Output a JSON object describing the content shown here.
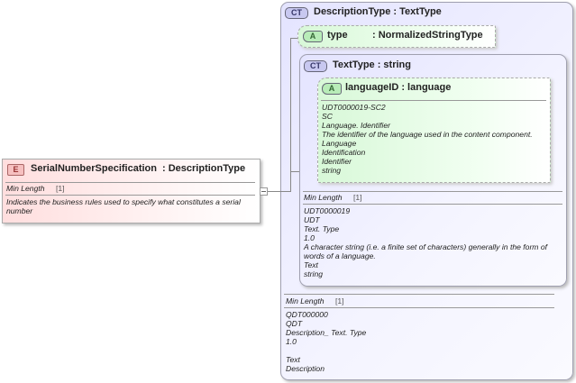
{
  "element": {
    "badge": "E",
    "name": "SerialNumberSpecification",
    "type": ": DescriptionType",
    "facet_label": "Min Length",
    "facet_value": "[1]",
    "doc": "Indicates the business rules used to specify what constitutes a serial number"
  },
  "outer": {
    "badge": "CT",
    "title": "DescriptionType : TextType",
    "facet_label": "Min Length",
    "facet_value": "[1]",
    "doc": [
      "QDT000000",
      "QDT",
      "Description_ Text. Type",
      "1.0",
      "",
      "Text",
      "Description"
    ]
  },
  "type_attr": {
    "badge": "A",
    "name": "type",
    "type": ": NormalizedStringType"
  },
  "inner": {
    "badge": "CT",
    "title": "TextType : string",
    "facet_label": "Min Length",
    "facet_value": "[1]",
    "doc": [
      "UDT0000019",
      "UDT",
      "Text. Type",
      "1.0",
      "A character string (i.e. a finite set of characters) generally in the form of words of a language.",
      "Text",
      "string"
    ]
  },
  "lang_attr": {
    "badge": "A",
    "name": "languageID : language",
    "doc": [
      "UDT0000019-SC2",
      "SC",
      "Language. Identifier",
      "The identifier of the language used in the content component.",
      "Language",
      "Identification",
      "Identifier",
      "string"
    ]
  }
}
